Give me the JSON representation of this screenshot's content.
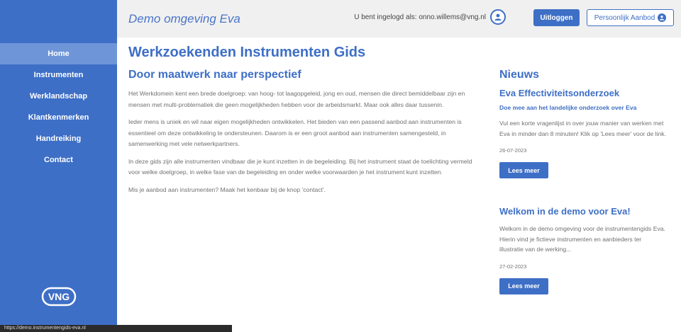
{
  "header": {
    "app_title": "Demo omgeving Eva",
    "login_text": "U bent ingelogd als: onno.willems@vng.nl",
    "logout_label": "Uitloggen",
    "offer_label": "Persoonlijk Aanbod"
  },
  "sidebar": {
    "items": [
      {
        "label": "Home"
      },
      {
        "label": "Instrumenten"
      },
      {
        "label": "Werklandschap"
      },
      {
        "label": "Klantkenmerken"
      },
      {
        "label": "Handreiking"
      },
      {
        "label": "Contact"
      }
    ],
    "logo_text": "VNG"
  },
  "main": {
    "title": "Werkzoekenden Instrumenten Gids",
    "subtitle": "Door maatwerk naar perspectief",
    "paragraphs": [
      "Het Werkdomein kent een brede doelgroep: van hoog- tot laagopgeleid, jong en oud, mensen die direct bemiddelbaar zijn en mensen met multi-problematiek die geen mogelijkheden hebben voor de arbeidsmarkt. Maar ook alles daar tussenin.",
      "Ieder mens is uniek en wil naar eigen mogelijkheden ontwikkelen. Het bieden van een passend aanbod aan instrumenten is essentieel om deze ontwikkeling te ondersteunen. Daarom is er een groot aanbod aan instrumenten samengesteld, in samenwerking met vele netwerkpartners.",
      "In deze gids zijn alle instrumenten vindbaar die je kunt inzetten in de begeleiding. Bij het instrument staat de toelichting vermeld voor welke doelgroep, in welke fase van de begeleiding en onder welke voorwaarden je het instrument kunt inzetten.",
      "Mis je aanbod aan instrumenten? Maak het kenbaar bij de knop 'contact'."
    ]
  },
  "news": {
    "heading": "Nieuws",
    "items": [
      {
        "title": "Eva Effectiviteitsonderzoek",
        "subtitle": "Doe mee aan het landelijke onderzoek over Eva",
        "text": "Vul een korte vragenlijst in over jouw manier van werken met Eva in minder dan 8 minuten! Klik op 'Lees meer' voor de link.",
        "date": "26-07-2023",
        "button": "Lees meer"
      },
      {
        "title": "Welkom in de demo voor Eva!",
        "subtitle": "",
        "text": "Welkom in de demo omgeving voor de instrumentengids Eva. Hierin vind je fictieve instrumenten en aanbieders ter illustratie van de werking...",
        "date": "27-02-2023",
        "button": "Lees meer"
      }
    ]
  },
  "status_bar": {
    "url": "https://demo.instrumentengids-eva.nl"
  },
  "colors": {
    "accent": "#3e6fc6",
    "sidebar_active": "#6e95d8",
    "header_bg": "#f0f0f0"
  }
}
